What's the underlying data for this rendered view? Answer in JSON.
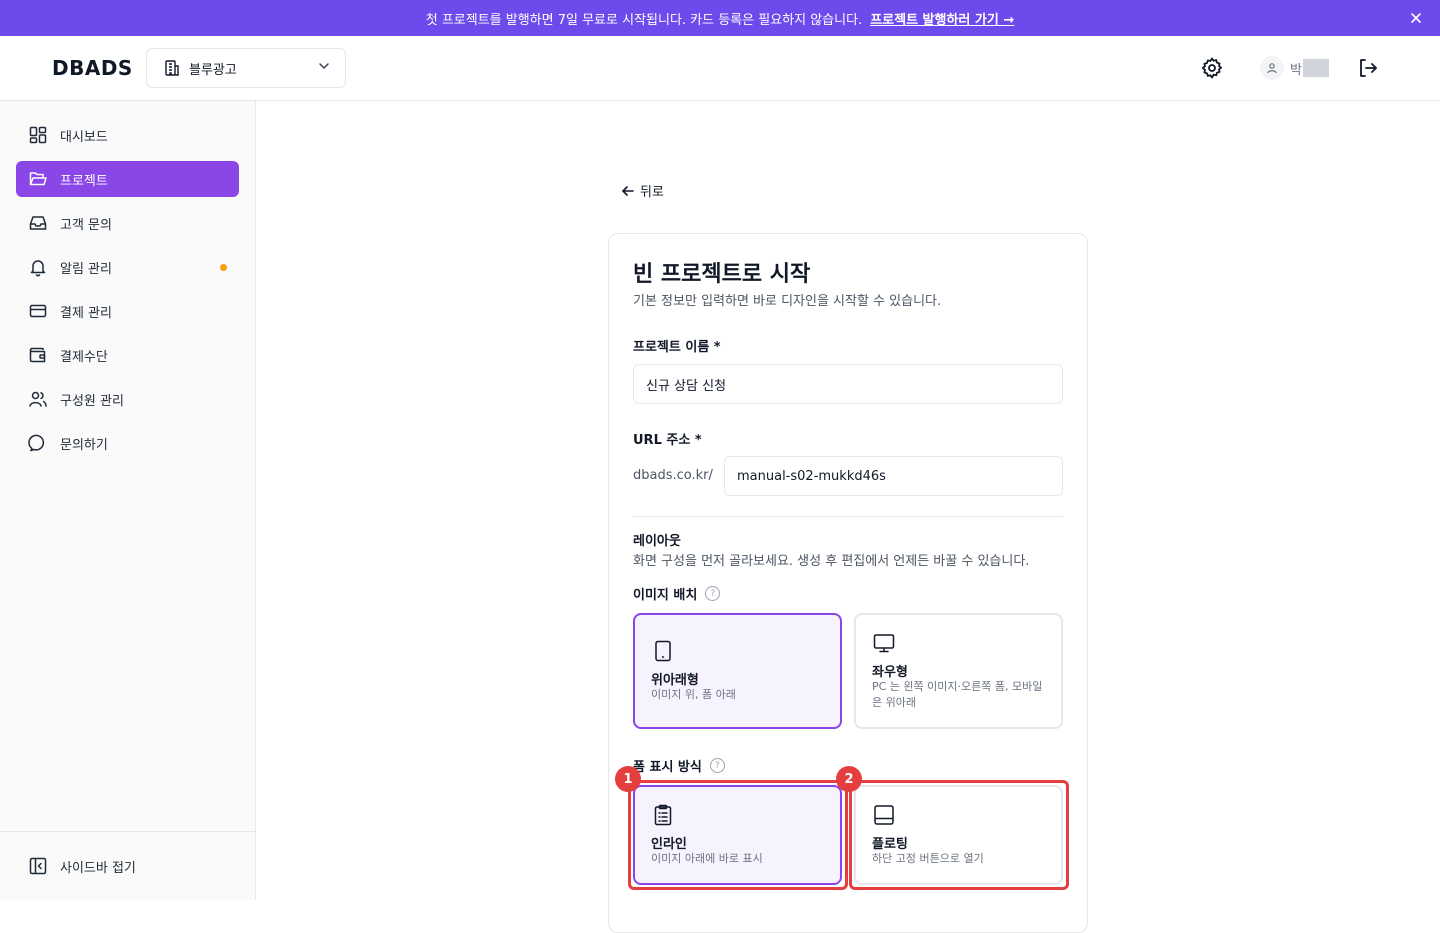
{
  "banner": {
    "message": "첫 프로젝트를 발행하면 7일 무료로 시작됩니다. 카드 등록은 필요하지 않습니다.",
    "link": "프로젝트 발행하러 가기 →"
  },
  "header": {
    "logo": "DBADS",
    "workspace": "블루광고",
    "user_name": "박"
  },
  "sidebar": {
    "items": [
      {
        "label": "대시보드",
        "icon": "dashboard-icon"
      },
      {
        "label": "프로젝트",
        "icon": "folder-icon",
        "active": true
      },
      {
        "label": "고객 문의",
        "icon": "inbox-icon"
      },
      {
        "label": "알림 관리",
        "icon": "bell-icon",
        "dot": true
      },
      {
        "label": "결제 관리",
        "icon": "credit-card-icon"
      },
      {
        "label": "결제수단",
        "icon": "wallet-icon"
      },
      {
        "label": "구성원 관리",
        "icon": "users-icon"
      },
      {
        "label": "문의하기",
        "icon": "chat-icon"
      }
    ],
    "collapse_label": "사이드바 접기"
  },
  "main": {
    "back_label": "뒤로",
    "title": "빈 프로젝트로 시작",
    "description": "기본 정보만 입력하면 바로 디자인을 시작할 수 있습니다.",
    "project_name_label": "프로젝트 이름 *",
    "project_name_value": "신규 상담 신청",
    "url_label": "URL 주소 *",
    "url_prefix": "dbads.co.kr/",
    "url_value": "manual-s02-mukkd46s",
    "layout_title": "레이아웃",
    "layout_desc": "화면 구성을 먼저 골라보세요. 생성 후 편집에서 언제든 바꿀 수 있습니다.",
    "image_placement_label": "이미지 배치",
    "image_options": [
      {
        "title": "위아래형",
        "desc": "이미지 위, 폼 아래",
        "selected": true
      },
      {
        "title": "좌우형",
        "desc": "PC 는 왼쪽 이미지·오른쪽 폼, 모바일은 위아래",
        "selected": false
      }
    ],
    "form_display_label": "폼 표시 방식",
    "form_options": [
      {
        "title": "인라인",
        "desc": "이미지 아래에 바로 표시",
        "selected": true,
        "badge": "1"
      },
      {
        "title": "플로팅",
        "desc": "하단 고정 버튼으로 열기",
        "selected": false,
        "badge": "2"
      }
    ],
    "help_glyph": "?"
  },
  "colors": {
    "banner": "#6d4aec",
    "accent": "#8b46e8",
    "highlight": "#e53e3e",
    "dot": "#f59e0b"
  }
}
